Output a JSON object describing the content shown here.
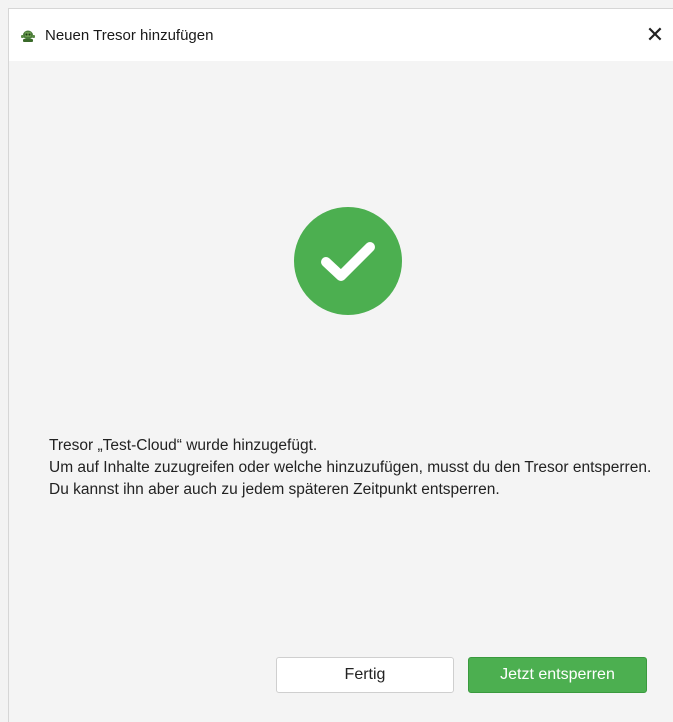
{
  "window": {
    "title": "Neuen Tresor hinzufügen",
    "app_icon": "cryptomator-bot-icon",
    "close_icon": "close-icon",
    "close_glyph": "✕"
  },
  "status": {
    "icon": "checkmark-circle-icon",
    "color": "#4caf50"
  },
  "message": {
    "line1": "Tresor „Test-Cloud“ wurde hinzugefügt.",
    "line2": "Um auf Inhalte zuzugreifen oder welche hinzuzufügen, musst du den Tresor entsperren. Du kannst ihn aber auch zu jedem späteren Zeitpunkt entsperren."
  },
  "buttons": {
    "done_label": "Fertig",
    "unlock_label": "Jetzt entsperren"
  },
  "colors": {
    "accent": "#4caf50",
    "background": "#f4f4f4",
    "titlebar": "#ffffff"
  }
}
